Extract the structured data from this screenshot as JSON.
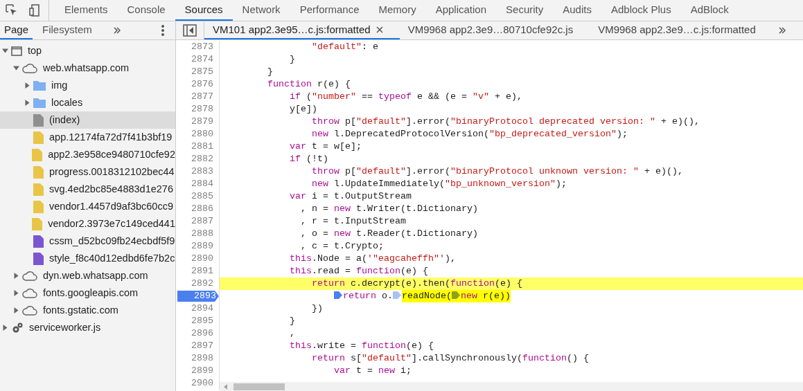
{
  "toolbar": {
    "tabs": [
      {
        "label": "Elements",
        "selected": false
      },
      {
        "label": "Console",
        "selected": false
      },
      {
        "label": "Sources",
        "selected": true
      },
      {
        "label": "Network",
        "selected": false
      },
      {
        "label": "Performance",
        "selected": false
      },
      {
        "label": "Memory",
        "selected": false
      },
      {
        "label": "Application",
        "selected": false
      },
      {
        "label": "Security",
        "selected": false
      },
      {
        "label": "Audits",
        "selected": false
      },
      {
        "label": "Adblock Plus",
        "selected": false
      },
      {
        "label": "AdBlock",
        "selected": false
      }
    ]
  },
  "navigator": {
    "tabs": [
      {
        "label": "Page",
        "selected": true
      },
      {
        "label": "Filesystem",
        "selected": false
      }
    ],
    "tree": [
      {
        "kind": "frame",
        "label": "top",
        "expanded": true,
        "selected": false,
        "children": [
          {
            "kind": "domain",
            "label": "web.whatsapp.com",
            "expanded": true,
            "selected": false,
            "children": [
              {
                "kind": "folder",
                "label": "img",
                "expanded": false,
                "selected": false
              },
              {
                "kind": "folder",
                "label": "locales",
                "expanded": false,
                "selected": false
              },
              {
                "kind": "document",
                "label": "(index)",
                "selected": true
              },
              {
                "kind": "script",
                "label": "app.12174fa72d7f41b3bf19",
                "selected": false
              },
              {
                "kind": "script",
                "label": "app2.3e958ce9480710cfe92",
                "selected": false
              },
              {
                "kind": "script",
                "label": "progress.0018312102bec44",
                "selected": false
              },
              {
                "kind": "script",
                "label": "svg.4ed2bc85e4883d1e276",
                "selected": false
              },
              {
                "kind": "script",
                "label": "vendor1.4457d9af3bc60cc9",
                "selected": false
              },
              {
                "kind": "script",
                "label": "vendor2.3973e7c149ced441",
                "selected": false
              },
              {
                "kind": "stylesheet",
                "label": "cssm_d52bc09fb24ecbdf5f9",
                "selected": false
              },
              {
                "kind": "stylesheet",
                "label": "style_f8c40d12edbd6fe7b2c",
                "selected": false
              }
            ]
          },
          {
            "kind": "domain",
            "label": "dyn.web.whatsapp.com",
            "expanded": false,
            "selected": false
          },
          {
            "kind": "domain",
            "label": "fonts.googleapis.com",
            "expanded": false,
            "selected": false
          },
          {
            "kind": "domain",
            "label": "fonts.gstatic.com",
            "expanded": false,
            "selected": false
          }
        ]
      },
      {
        "kind": "worker",
        "label": "serviceworker.js",
        "expanded": false,
        "selected": false
      }
    ]
  },
  "editor": {
    "tabs": [
      {
        "label": "VM101 app2.3e95…c.js:formatted",
        "selected": true,
        "closable": true
      },
      {
        "label": "VM9968 app2.3e9…80710cfe92c.js",
        "selected": false,
        "closable": false
      },
      {
        "label": "VM9968 app2.3e9…c.js:formatted",
        "selected": false,
        "closable": false
      }
    ],
    "lines": [
      {
        "children": [
          {
            "children": [
              {
                "children": [
                  {
                    "children": [
                      {
                        "number": "2873",
                        "tokens": [
                          {
                            "kind": "string",
                            "text": "\"default\""
                          },
                          {
                            "kind": "plain",
                            "text": ": e"
                          }
                        ]
                      }
                    ]
                  },
                  {
                    "number": "2874",
                    "tokens": [
                      {
                        "kind": "plain",
                        "text": "}"
                      }
                    ]
                  }
                ]
              },
              {
                "number": "2875",
                "tokens": [
                  {
                    "kind": "plain",
                    "text": "}"
                  }
                ]
              },
              {
                "number": "2876",
                "tokens": [
                  {
                    "kind": "keyword",
                    "text": "function"
                  },
                  {
                    "kind": "plain",
                    "text": " r(e) {"
                  }
                ]
              },
              {
                "children": [
                  {
                    "number": "2877",
                    "tokens": [
                      {
                        "kind": "keyword",
                        "text": "if"
                      },
                      {
                        "kind": "plain",
                        "text": " ("
                      },
                      {
                        "kind": "string",
                        "text": "\"number\""
                      },
                      {
                        "kind": "plain",
                        "text": " == "
                      },
                      {
                        "kind": "keyword",
                        "text": "typeof"
                      },
                      {
                        "kind": "plain",
                        "text": " e && (e = "
                      },
                      {
                        "kind": "string",
                        "text": "\"v\""
                      },
                      {
                        "kind": "plain",
                        "text": " + e),"
                      }
                    ]
                  },
                  {
                    "number": "2878",
                    "tokens": [
                      {
                        "kind": "plain",
                        "text": "y[e])"
                      }
                    ]
                  },
                  {
                    "children": [
                      {
                        "number": "2879",
                        "tokens": [
                          {
                            "kind": "keyword",
                            "text": "throw"
                          },
                          {
                            "kind": "plain",
                            "text": " p["
                          },
                          {
                            "kind": "string",
                            "text": "\"default\""
                          },
                          {
                            "kind": "plain",
                            "text": "].error("
                          },
                          {
                            "kind": "string",
                            "text": "\"binaryProtocol deprecated version: \""
                          },
                          {
                            "kind": "plain",
                            "text": " + e)(),"
                          }
                        ]
                      },
                      {
                        "number": "2880",
                        "tokens": [
                          {
                            "kind": "keyword",
                            "text": "new"
                          },
                          {
                            "kind": "plain",
                            "text": " l.DeprecatedProtocolVersion("
                          },
                          {
                            "kind": "string",
                            "text": "\"bp_deprecated_version\""
                          },
                          {
                            "kind": "plain",
                            "text": ");"
                          }
                        ]
                      }
                    ]
                  },
                  {
                    "number": "2881",
                    "tokens": [
                      {
                        "kind": "keyword",
                        "text": "var"
                      },
                      {
                        "kind": "plain",
                        "text": " t = w[e];"
                      }
                    ]
                  },
                  {
                    "number": "2882",
                    "tokens": [
                      {
                        "kind": "keyword",
                        "text": "if"
                      },
                      {
                        "kind": "plain",
                        "text": " (!t)"
                      }
                    ]
                  },
                  {
                    "children": [
                      {
                        "number": "2883",
                        "tokens": [
                          {
                            "kind": "keyword",
                            "text": "throw"
                          },
                          {
                            "kind": "plain",
                            "text": " p["
                          },
                          {
                            "kind": "string",
                            "text": "\"default\""
                          },
                          {
                            "kind": "plain",
                            "text": "].error("
                          },
                          {
                            "kind": "string",
                            "text": "\"binaryProtocol unknown version: \""
                          },
                          {
                            "kind": "plain",
                            "text": " + e)(),"
                          }
                        ]
                      },
                      {
                        "number": "2884",
                        "tokens": [
                          {
                            "kind": "keyword",
                            "text": "new"
                          },
                          {
                            "kind": "plain",
                            "text": " l.UpdateImmediately("
                          },
                          {
                            "kind": "string",
                            "text": "\"bp_unknown_version\""
                          },
                          {
                            "kind": "plain",
                            "text": ");"
                          }
                        ]
                      }
                    ]
                  },
                  {
                    "number": "2885",
                    "tokens": [
                      {
                        "kind": "keyword",
                        "text": "var"
                      },
                      {
                        "kind": "plain",
                        "text": " i = t.OutputStream"
                      }
                    ]
                  },
                  {
                    "number": "2886",
                    "continuation": true,
                    "tokens": [
                      {
                        "kind": "plain",
                        "text": ", n = "
                      },
                      {
                        "kind": "keyword",
                        "text": "new"
                      },
                      {
                        "kind": "plain",
                        "text": " t.Writer(t.Dictionary)"
                      }
                    ]
                  },
                  {
                    "number": "2887",
                    "continuation": true,
                    "tokens": [
                      {
                        "kind": "plain",
                        "text": ", r = t.InputStream"
                      }
                    ]
                  },
                  {
                    "number": "2888",
                    "continuation": true,
                    "tokens": [
                      {
                        "kind": "plain",
                        "text": ", o = "
                      },
                      {
                        "kind": "keyword",
                        "text": "new"
                      },
                      {
                        "kind": "plain",
                        "text": " t.Reader(t.Dictionary)"
                      }
                    ]
                  },
                  {
                    "number": "2889",
                    "continuation": true,
                    "tokens": [
                      {
                        "kind": "plain",
                        "text": ", c = t.Crypto;"
                      }
                    ]
                  },
                  {
                    "number": "2890",
                    "tokens": [
                      {
                        "kind": "keyword",
                        "text": "this"
                      },
                      {
                        "kind": "plain",
                        "text": ".Node = a("
                      },
                      {
                        "kind": "string",
                        "text": "'\"eagcaheffh\"'"
                      },
                      {
                        "kind": "plain",
                        "text": "),"
                      }
                    ]
                  },
                  {
                    "number": "2891",
                    "tokens": [
                      {
                        "kind": "keyword",
                        "text": "this"
                      },
                      {
                        "kind": "plain",
                        "text": ".read = "
                      },
                      {
                        "kind": "keyword",
                        "text": "function"
                      },
                      {
                        "kind": "plain",
                        "text": "(e) {"
                      }
                    ]
                  },
                  {
                    "children": [
                      {
                        "number": "2892",
                        "paused": true,
                        "tokens": [
                          {
                            "kind": "keyword",
                            "text": "return"
                          },
                          {
                            "kind": "plain",
                            "text": " c.decrypt(e).then("
                          },
                          {
                            "kind": "keyword",
                            "text": "function"
                          },
                          {
                            "kind": "plain",
                            "text": "(e) {"
                          }
                        ]
                      },
                      {
                        "children": [
                          {
                            "number": "2893",
                            "breakpoint": true,
                            "tokens": [
                              {
                                "kind": "marker",
                                "active": true
                              },
                              {
                                "kind": "keyword",
                                "text": "return"
                              },
                              {
                                "kind": "plain",
                                "text": " o."
                              },
                              {
                                "kind": "marker",
                                "active": false
                              },
                              {
                                "kind": "plain",
                                "text": "readNode(",
                                "highlighted": true
                              },
                              {
                                "kind": "marker",
                                "active": false,
                                "highlighted": true
                              },
                              {
                                "kind": "keyword",
                                "text": "new",
                                "highlighted": true
                              },
                              {
                                "kind": "plain",
                                "text": " r(e))",
                                "highlighted": true
                              }
                            ]
                          }
                        ]
                      },
                      {
                        "number": "2894",
                        "tokens": [
                          {
                            "kind": "plain",
                            "text": "})"
                          }
                        ]
                      }
                    ]
                  },
                  {
                    "number": "2895",
                    "tokens": [
                      {
                        "kind": "plain",
                        "text": "}"
                      }
                    ]
                  },
                  {
                    "number": "2896",
                    "tokens": [
                      {
                        "kind": "plain",
                        "text": ","
                      }
                    ]
                  },
                  {
                    "number": "2897",
                    "tokens": [
                      {
                        "kind": "keyword",
                        "text": "this"
                      },
                      {
                        "kind": "plain",
                        "text": ".write = "
                      },
                      {
                        "kind": "keyword",
                        "text": "function"
                      },
                      {
                        "kind": "plain",
                        "text": "(e) {"
                      }
                    ]
                  },
                  {
                    "children": [
                      {
                        "number": "2898",
                        "tokens": [
                          {
                            "kind": "keyword",
                            "text": "return"
                          },
                          {
                            "kind": "plain",
                            "text": " s["
                          },
                          {
                            "kind": "string",
                            "text": "\"default\""
                          },
                          {
                            "kind": "plain",
                            "text": "].callSynchronously("
                          },
                          {
                            "kind": "keyword",
                            "text": "function"
                          },
                          {
                            "kind": "plain",
                            "text": "() {"
                          }
                        ]
                      },
                      {
                        "children": [
                          {
                            "number": "2899",
                            "tokens": [
                              {
                                "kind": "keyword",
                                "text": "var"
                              },
                              {
                                "kind": "plain",
                                "text": " t = "
                              },
                              {
                                "kind": "keyword",
                                "text": "new"
                              },
                              {
                                "kind": "plain",
                                "text": " i;"
                              }
                            ]
                          }
                        ]
                      }
                    ]
                  }
                ]
              }
            ]
          },
          {
            "number": "2900"
          }
        ]
      }
    ]
  }
}
